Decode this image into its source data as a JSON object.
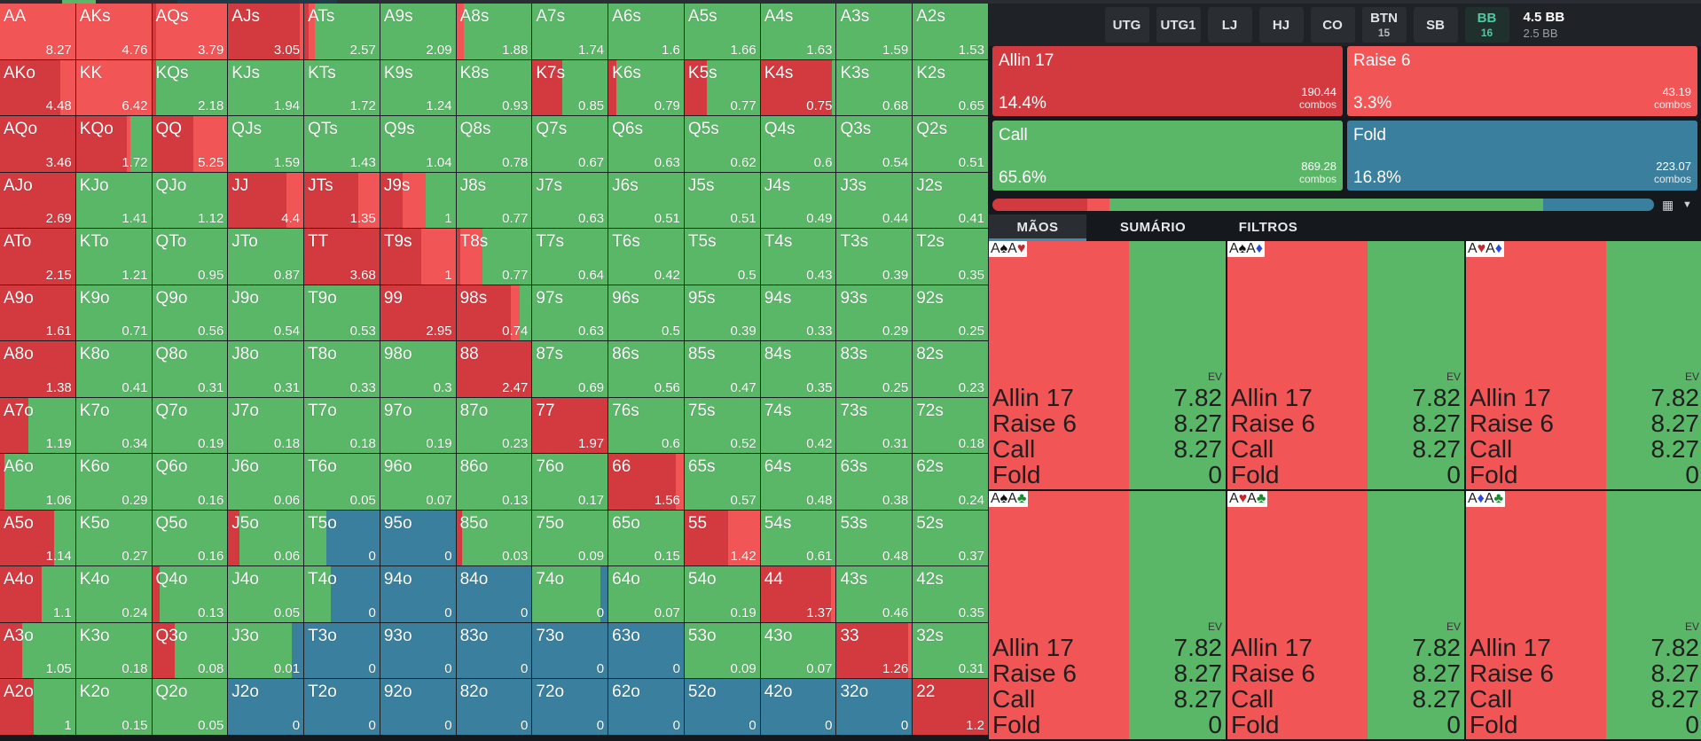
{
  "colors": {
    "allin": "#d23a3f",
    "raise": "#f25556",
    "call": "#5bb768",
    "fold": "#3a7f9d"
  },
  "matrix": {
    "rows": [
      [
        {
          "h": "AA",
          "ev": "8.27",
          "r": 1
        },
        {
          "h": "AKs",
          "ev": "4.76",
          "r": 1
        },
        {
          "h": "AQs",
          "ev": "3.79",
          "a": 0.05,
          "r": 0.95
        },
        {
          "h": "AJs",
          "ev": "3.05",
          "a": 0.95,
          "r": 0.05
        },
        {
          "h": "ATs",
          "ev": "2.57",
          "a": 0.06,
          "r": 0.08,
          "c": 0.86
        },
        {
          "h": "A9s",
          "ev": "2.09",
          "c": 1
        },
        {
          "h": "A8s",
          "ev": "1.88",
          "r": 0.1,
          "c": 0.9
        },
        {
          "h": "A7s",
          "ev": "1.74",
          "c": 1
        },
        {
          "h": "A6s",
          "ev": "1.6",
          "c": 1
        },
        {
          "h": "A5s",
          "ev": "1.66",
          "c": 1
        },
        {
          "h": "A4s",
          "ev": "1.63",
          "c": 1
        },
        {
          "h": "A3s",
          "ev": "1.59",
          "c": 1
        },
        {
          "h": "A2s",
          "ev": "1.53",
          "c": 1
        }
      ],
      [
        {
          "h": "AKo",
          "ev": "4.48",
          "a": 0.8,
          "r": 0.2
        },
        {
          "h": "KK",
          "ev": "6.42",
          "r": 1
        },
        {
          "h": "KQs",
          "ev": "2.18",
          "a": 0.05,
          "c": 0.95
        },
        {
          "h": "KJs",
          "ev": "1.94",
          "c": 1
        },
        {
          "h": "KTs",
          "ev": "1.72",
          "c": 1
        },
        {
          "h": "K9s",
          "ev": "1.24",
          "c": 1
        },
        {
          "h": "K8s",
          "ev": "0.93",
          "c": 1
        },
        {
          "h": "K7s",
          "ev": "0.85",
          "a": 0.4,
          "c": 0.6
        },
        {
          "h": "K6s",
          "ev": "0.79",
          "a": 0.1,
          "c": 0.9
        },
        {
          "h": "K5s",
          "ev": "0.77",
          "a": 0.3,
          "c": 0.7
        },
        {
          "h": "K4s",
          "ev": "0.75",
          "a": 0.95,
          "c": 0.05
        },
        {
          "h": "K3s",
          "ev": "0.68",
          "c": 1
        },
        {
          "h": "K2s",
          "ev": "0.65",
          "c": 1
        }
      ],
      [
        {
          "h": "AQo",
          "ev": "3.46",
          "a": 1
        },
        {
          "h": "KQo",
          "ev": "1.72",
          "a": 0.67,
          "r": 0.05,
          "c": 0.28
        },
        {
          "h": "QQ",
          "ev": "5.25",
          "a": 0.55,
          "r": 0.45
        },
        {
          "h": "QJs",
          "ev": "1.59",
          "c": 1
        },
        {
          "h": "QTs",
          "ev": "1.43",
          "c": 1
        },
        {
          "h": "Q9s",
          "ev": "1.04",
          "c": 1
        },
        {
          "h": "Q8s",
          "ev": "0.78",
          "c": 1
        },
        {
          "h": "Q7s",
          "ev": "0.67",
          "c": 1
        },
        {
          "h": "Q6s",
          "ev": "0.63",
          "c": 1
        },
        {
          "h": "Q5s",
          "ev": "0.62",
          "c": 1
        },
        {
          "h": "Q4s",
          "ev": "0.6",
          "c": 1
        },
        {
          "h": "Q3s",
          "ev": "0.54",
          "c": 1
        },
        {
          "h": "Q2s",
          "ev": "0.51",
          "c": 1
        }
      ],
      [
        {
          "h": "AJo",
          "ev": "2.69",
          "a": 1
        },
        {
          "h": "KJo",
          "ev": "1.41",
          "c": 1
        },
        {
          "h": "QJo",
          "ev": "1.12",
          "c": 1
        },
        {
          "h": "JJ",
          "ev": "4.4",
          "a": 0.78,
          "r": 0.22
        },
        {
          "h": "JTs",
          "ev": "1.35",
          "a": 0.72,
          "r": 0.28
        },
        {
          "h": "J9s",
          "ev": "1",
          "a": 0.3,
          "r": 0.3,
          "c": 0.4
        },
        {
          "h": "J8s",
          "ev": "0.77",
          "c": 1
        },
        {
          "h": "J7s",
          "ev": "0.63",
          "c": 1
        },
        {
          "h": "J6s",
          "ev": "0.51",
          "c": 1
        },
        {
          "h": "J5s",
          "ev": "0.51",
          "c": 1
        },
        {
          "h": "J4s",
          "ev": "0.49",
          "c": 1
        },
        {
          "h": "J3s",
          "ev": "0.44",
          "c": 1
        },
        {
          "h": "J2s",
          "ev": "0.41",
          "c": 1
        }
      ],
      [
        {
          "h": "ATo",
          "ev": "2.15",
          "a": 1
        },
        {
          "h": "KTo",
          "ev": "1.21",
          "c": 1
        },
        {
          "h": "QTo",
          "ev": "0.95",
          "c": 1
        },
        {
          "h": "JTo",
          "ev": "0.87",
          "c": 1
        },
        {
          "h": "TT",
          "ev": "3.68",
          "a": 1
        },
        {
          "h": "T9s",
          "ev": "1",
          "a": 0.55,
          "r": 0.45
        },
        {
          "h": "T8s",
          "ev": "0.77",
          "a": 0.05,
          "r": 0.3,
          "c": 0.65
        },
        {
          "h": "T7s",
          "ev": "0.64",
          "c": 1
        },
        {
          "h": "T6s",
          "ev": "0.42",
          "c": 1
        },
        {
          "h": "T5s",
          "ev": "0.5",
          "c": 1
        },
        {
          "h": "T4s",
          "ev": "0.43",
          "c": 1
        },
        {
          "h": "T3s",
          "ev": "0.39",
          "c": 1
        },
        {
          "h": "T2s",
          "ev": "0.35",
          "c": 1
        }
      ],
      [
        {
          "h": "A9o",
          "ev": "1.61",
          "a": 1
        },
        {
          "h": "K9o",
          "ev": "0.71",
          "c": 1
        },
        {
          "h": "Q9o",
          "ev": "0.56",
          "c": 1
        },
        {
          "h": "J9o",
          "ev": "0.54",
          "c": 1
        },
        {
          "h": "T9o",
          "ev": "0.53",
          "c": 1
        },
        {
          "h": "99",
          "ev": "2.95",
          "a": 1
        },
        {
          "h": "98s",
          "ev": "0.74",
          "a": 0.72,
          "r": 0.12,
          "c": 0.16
        },
        {
          "h": "97s",
          "ev": "0.63",
          "c": 1
        },
        {
          "h": "96s",
          "ev": "0.5",
          "c": 1
        },
        {
          "h": "95s",
          "ev": "0.39",
          "c": 1
        },
        {
          "h": "94s",
          "ev": "0.33",
          "c": 1
        },
        {
          "h": "93s",
          "ev": "0.29",
          "c": 1
        },
        {
          "h": "92s",
          "ev": "0.25",
          "c": 1
        }
      ],
      [
        {
          "h": "A8o",
          "ev": "1.38",
          "a": 1
        },
        {
          "h": "K8o",
          "ev": "0.41",
          "c": 1
        },
        {
          "h": "Q8o",
          "ev": "0.31",
          "c": 1
        },
        {
          "h": "J8o",
          "ev": "0.31",
          "c": 1
        },
        {
          "h": "T8o",
          "ev": "0.33",
          "c": 1
        },
        {
          "h": "98o",
          "ev": "0.3",
          "c": 1
        },
        {
          "h": "88",
          "ev": "2.47",
          "a": 1
        },
        {
          "h": "87s",
          "ev": "0.69",
          "c": 1
        },
        {
          "h": "86s",
          "ev": "0.56",
          "c": 1
        },
        {
          "h": "85s",
          "ev": "0.47",
          "c": 1
        },
        {
          "h": "84s",
          "ev": "0.35",
          "c": 1
        },
        {
          "h": "83s",
          "ev": "0.25",
          "c": 1
        },
        {
          "h": "82s",
          "ev": "0.23",
          "c": 1
        }
      ],
      [
        {
          "h": "A7o",
          "ev": "1.19",
          "a": 0.38,
          "c": 0.62
        },
        {
          "h": "K7o",
          "ev": "0.34",
          "c": 1
        },
        {
          "h": "Q7o",
          "ev": "0.19",
          "c": 1
        },
        {
          "h": "J7o",
          "ev": "0.18",
          "c": 1
        },
        {
          "h": "T7o",
          "ev": "0.18",
          "c": 1
        },
        {
          "h": "97o",
          "ev": "0.19",
          "c": 1
        },
        {
          "h": "87o",
          "ev": "0.23",
          "c": 1
        },
        {
          "h": "77",
          "ev": "1.97",
          "a": 1
        },
        {
          "h": "76s",
          "ev": "0.6",
          "c": 1
        },
        {
          "h": "75s",
          "ev": "0.52",
          "c": 1
        },
        {
          "h": "74s",
          "ev": "0.42",
          "c": 1
        },
        {
          "h": "73s",
          "ev": "0.31",
          "c": 1
        },
        {
          "h": "72s",
          "ev": "0.18",
          "c": 1
        }
      ],
      [
        {
          "h": "A6o",
          "ev": "1.06",
          "a": 0.06,
          "c": 0.94
        },
        {
          "h": "K6o",
          "ev": "0.29",
          "c": 1
        },
        {
          "h": "Q6o",
          "ev": "0.16",
          "c": 1
        },
        {
          "h": "J6o",
          "ev": "0.06",
          "c": 1
        },
        {
          "h": "T6o",
          "ev": "0.05",
          "c": 1
        },
        {
          "h": "96o",
          "ev": "0.07",
          "c": 1
        },
        {
          "h": "86o",
          "ev": "0.13",
          "c": 1
        },
        {
          "h": "76o",
          "ev": "0.17",
          "c": 1
        },
        {
          "h": "66",
          "ev": "1.56",
          "a": 0.9,
          "r": 0.1
        },
        {
          "h": "65s",
          "ev": "0.57",
          "c": 1
        },
        {
          "h": "64s",
          "ev": "0.48",
          "c": 1
        },
        {
          "h": "63s",
          "ev": "0.38",
          "c": 1
        },
        {
          "h": "62s",
          "ev": "0.24",
          "c": 1
        }
      ],
      [
        {
          "h": "A5o",
          "ev": "1.14",
          "a": 0.72,
          "c": 0.28
        },
        {
          "h": "K5o",
          "ev": "0.27",
          "c": 1
        },
        {
          "h": "Q5o",
          "ev": "0.16",
          "c": 1
        },
        {
          "h": "J5o",
          "ev": "0.06",
          "a": 0.15,
          "c": 0.85
        },
        {
          "h": "T5o",
          "ev": "0",
          "c": 0.3,
          "f": 0.7
        },
        {
          "h": "95o",
          "ev": "0",
          "f": 1
        },
        {
          "h": "85o",
          "ev": "0.03",
          "a": 0.08,
          "c": 0.92
        },
        {
          "h": "75o",
          "ev": "0.09",
          "c": 1
        },
        {
          "h": "65o",
          "ev": "0.15",
          "c": 1
        },
        {
          "h": "55",
          "ev": "1.42",
          "a": 0.58,
          "r": 0.42
        },
        {
          "h": "54s",
          "ev": "0.61",
          "c": 1
        },
        {
          "h": "53s",
          "ev": "0.48",
          "c": 1
        },
        {
          "h": "52s",
          "ev": "0.37",
          "c": 1
        }
      ],
      [
        {
          "h": "A4o",
          "ev": "1.1",
          "a": 0.55,
          "c": 0.45
        },
        {
          "h": "K4o",
          "ev": "0.24",
          "c": 1
        },
        {
          "h": "Q4o",
          "ev": "0.13",
          "a": 0.1,
          "c": 0.9
        },
        {
          "h": "J4o",
          "ev": "0.05",
          "c": 1
        },
        {
          "h": "T4o",
          "ev": "0",
          "c": 0.35,
          "f": 0.65
        },
        {
          "h": "94o",
          "ev": "0",
          "f": 1
        },
        {
          "h": "84o",
          "ev": "0",
          "f": 1
        },
        {
          "h": "74o",
          "ev": "0",
          "c": 0.9,
          "f": 0.1
        },
        {
          "h": "64o",
          "ev": "0.07",
          "c": 1
        },
        {
          "h": "54o",
          "ev": "0.19",
          "c": 1
        },
        {
          "h": "44",
          "ev": "1.37",
          "a": 0.93,
          "r": 0.07
        },
        {
          "h": "43s",
          "ev": "0.46",
          "c": 1
        },
        {
          "h": "42s",
          "ev": "0.35",
          "c": 1
        }
      ],
      [
        {
          "h": "A3o",
          "ev": "1.05",
          "a": 0.3,
          "c": 0.7
        },
        {
          "h": "K3o",
          "ev": "0.18",
          "c": 1
        },
        {
          "h": "Q3o",
          "ev": "0.08",
          "a": 0.3,
          "c": 0.7
        },
        {
          "h": "J3o",
          "ev": "0.01",
          "c": 0.85,
          "f": 0.15
        },
        {
          "h": "T3o",
          "ev": "0",
          "f": 1
        },
        {
          "h": "93o",
          "ev": "0",
          "f": 1
        },
        {
          "h": "83o",
          "ev": "0",
          "f": 1
        },
        {
          "h": "73o",
          "ev": "0",
          "f": 1
        },
        {
          "h": "63o",
          "ev": "0",
          "f": 1
        },
        {
          "h": "53o",
          "ev": "0.09",
          "c": 1
        },
        {
          "h": "43o",
          "ev": "0.07",
          "c": 1
        },
        {
          "h": "33",
          "ev": "1.26",
          "a": 0.95,
          "r": 0.05
        },
        {
          "h": "32s",
          "ev": "0.31",
          "c": 1
        }
      ],
      [
        {
          "h": "A2o",
          "ev": "1",
          "a": 0.45,
          "c": 0.55
        },
        {
          "h": "K2o",
          "ev": "0.15",
          "c": 1
        },
        {
          "h": "Q2o",
          "ev": "0.05",
          "c": 1
        },
        {
          "h": "J2o",
          "ev": "0",
          "f": 1
        },
        {
          "h": "T2o",
          "ev": "0",
          "f": 1
        },
        {
          "h": "92o",
          "ev": "0",
          "f": 1
        },
        {
          "h": "82o",
          "ev": "0",
          "f": 1
        },
        {
          "h": "72o",
          "ev": "0",
          "f": 1
        },
        {
          "h": "62o",
          "ev": "0",
          "f": 1
        },
        {
          "h": "52o",
          "ev": "0",
          "f": 1
        },
        {
          "h": "42o",
          "ev": "0",
          "f": 1
        },
        {
          "h": "32o",
          "ev": "0",
          "f": 1
        },
        {
          "h": "22",
          "ev": "1.2",
          "a": 1
        }
      ]
    ]
  },
  "positions": [
    {
      "label": "UTG",
      "stack": ""
    },
    {
      "label": "UTG1",
      "stack": ""
    },
    {
      "label": "LJ",
      "stack": ""
    },
    {
      "label": "HJ",
      "stack": ""
    },
    {
      "label": "CO",
      "stack": ""
    },
    {
      "label": "BTN",
      "stack": "15"
    },
    {
      "label": "SB",
      "stack": ""
    },
    {
      "label": "BB",
      "stack": "16",
      "active": true
    }
  ],
  "pot": {
    "main": "4.5 BB",
    "sub": "2.5 BB"
  },
  "actions": {
    "allin": {
      "name": "Allin 17",
      "pct": "14.4%",
      "combos": "190.44",
      "combos_label": "combos"
    },
    "raise": {
      "name": "Raise 6",
      "pct": "3.3%",
      "combos": "43.19",
      "combos_label": "combos"
    },
    "call": {
      "name": "Call",
      "pct": "65.6%",
      "combos": "869.28",
      "combos_label": "combos"
    },
    "fold": {
      "name": "Fold",
      "pct": "16.8%",
      "combos": "223.07",
      "combos_label": "combos"
    }
  },
  "strategy_bar": {
    "allin": 0.144,
    "raise": 0.033,
    "call": 0.656,
    "fold": 0.168
  },
  "tabs": {
    "hands": "MÃOS",
    "summary": "SUMÁRIO",
    "filters": "FILTROS"
  },
  "combos": {
    "ev_label": "EV",
    "items": [
      {
        "c1": "A",
        "s1": "♠",
        "k1": "#111",
        "c2": "A",
        "s2": "♥",
        "k2": "#c1272d",
        "split": [
          0.59,
          0.41
        ],
        "rows": [
          [
            "Allin 17",
            "7.82"
          ],
          [
            "Raise 6",
            "8.27"
          ],
          [
            "Call",
            "8.27"
          ],
          [
            "Fold",
            "0"
          ]
        ]
      },
      {
        "c1": "A",
        "s1": "♠",
        "k1": "#111",
        "c2": "A",
        "s2": "♦",
        "k2": "#2a4bd7",
        "split": [
          0.59,
          0.41
        ],
        "rows": [
          [
            "Allin 17",
            "7.82"
          ],
          [
            "Raise 6",
            "8.27"
          ],
          [
            "Call",
            "8.27"
          ],
          [
            "Fold",
            "0"
          ]
        ]
      },
      {
        "c1": "A",
        "s1": "♥",
        "k1": "#c1272d",
        "c2": "A",
        "s2": "♦",
        "k2": "#2a4bd7",
        "split": [
          0.59,
          0.41
        ],
        "rows": [
          [
            "Allin 17",
            "7.82"
          ],
          [
            "Raise 6",
            "8.27"
          ],
          [
            "Call",
            "8.27"
          ],
          [
            "Fold",
            "0"
          ]
        ]
      },
      {
        "c1": "A",
        "s1": "♠",
        "k1": "#111",
        "c2": "A",
        "s2": "♣",
        "k2": "#1a8a2f",
        "split": [
          0.59,
          0.41
        ],
        "rows": [
          [
            "Allin 17",
            "7.82"
          ],
          [
            "Raise 6",
            "8.27"
          ],
          [
            "Call",
            "8.27"
          ],
          [
            "Fold",
            "0"
          ]
        ]
      },
      {
        "c1": "A",
        "s1": "♥",
        "k1": "#c1272d",
        "c2": "A",
        "s2": "♣",
        "k2": "#1a8a2f",
        "split": [
          0.59,
          0.41
        ],
        "rows": [
          [
            "Allin 17",
            "7.82"
          ],
          [
            "Raise 6",
            "8.27"
          ],
          [
            "Call",
            "8.27"
          ],
          [
            "Fold",
            "0"
          ]
        ]
      },
      {
        "c1": "A",
        "s1": "♦",
        "k1": "#2a4bd7",
        "c2": "A",
        "s2": "♣",
        "k2": "#1a8a2f",
        "split": [
          0.59,
          0.41
        ],
        "rows": [
          [
            "Allin 17",
            "7.82"
          ],
          [
            "Raise 6",
            "8.27"
          ],
          [
            "Call",
            "8.27"
          ],
          [
            "Fold",
            "0"
          ]
        ]
      }
    ]
  }
}
